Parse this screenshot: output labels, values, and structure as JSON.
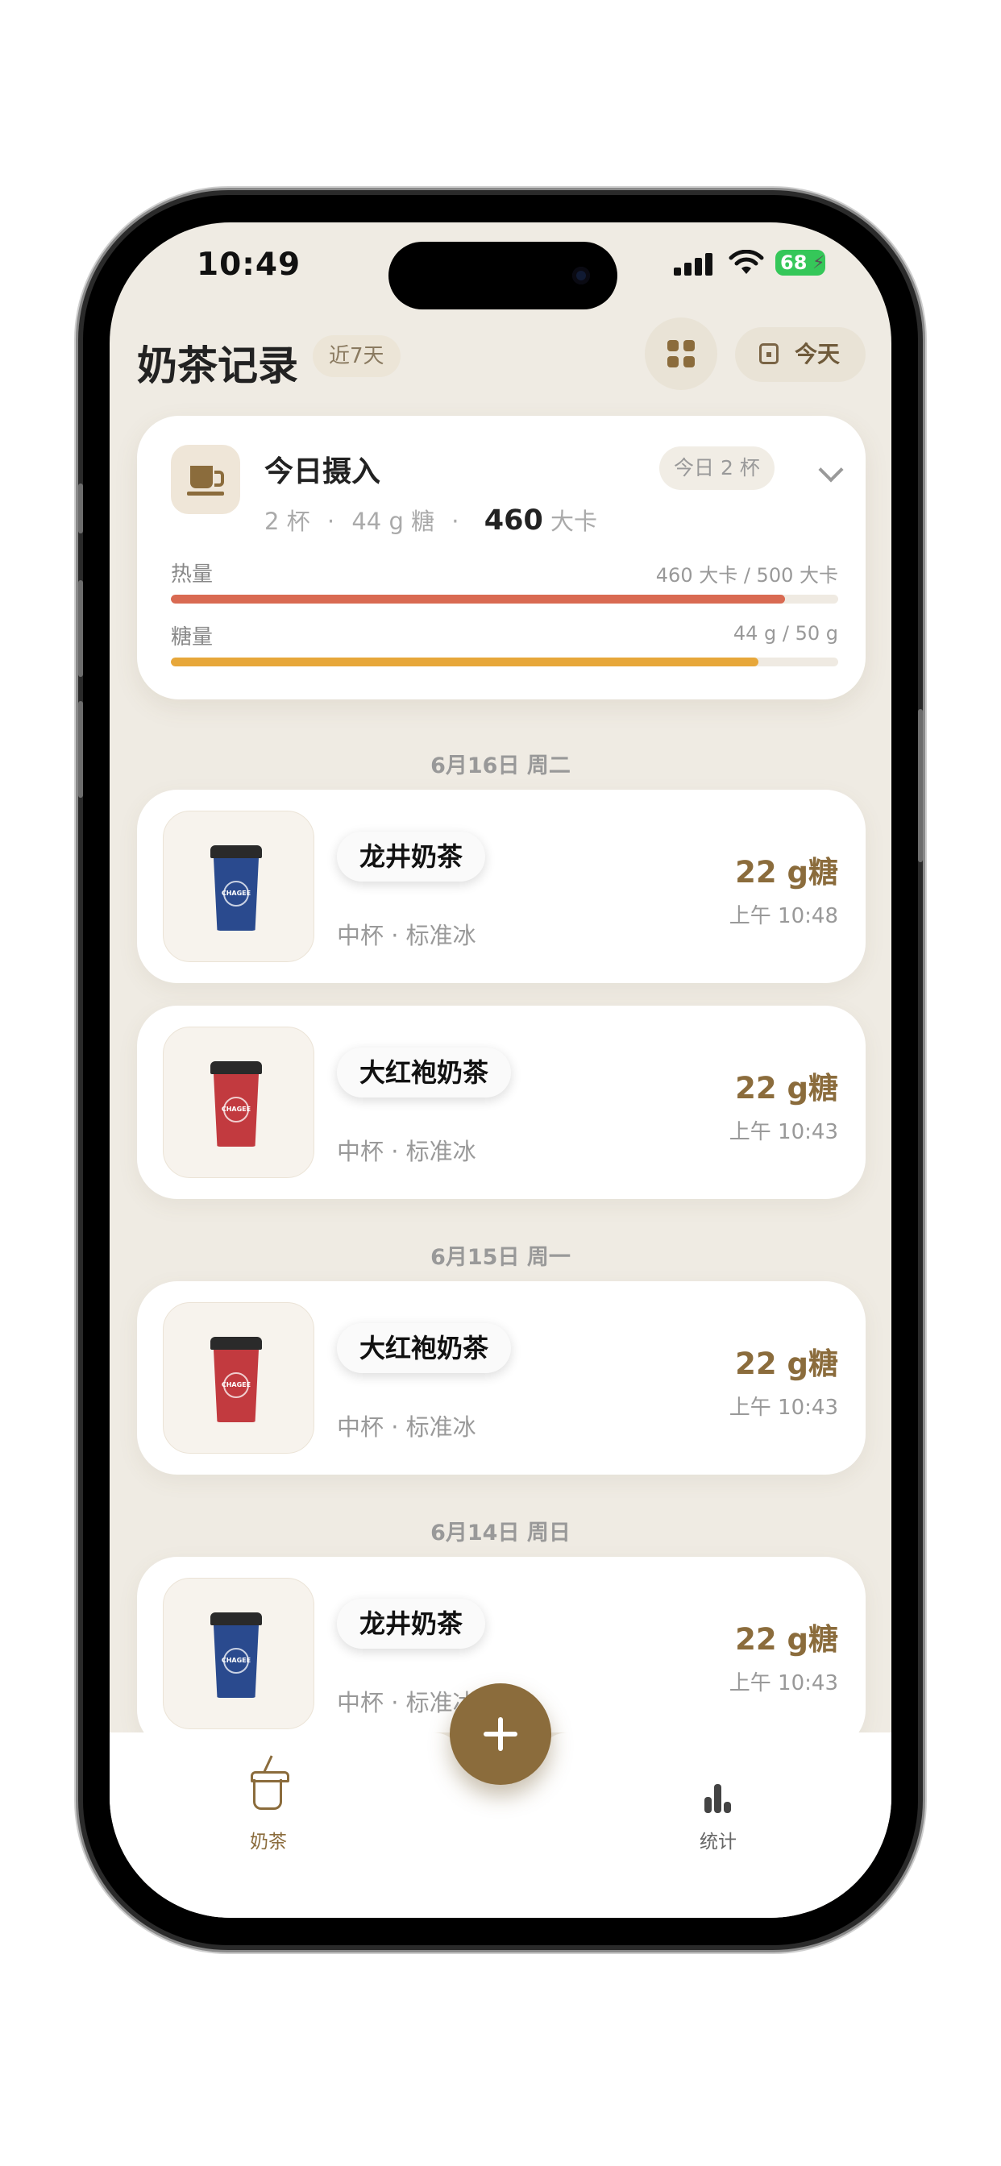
{
  "status": {
    "time": "10:49",
    "battery": "68"
  },
  "header": {
    "title": "奶茶记录",
    "range_badge": "近7天",
    "today_label": "今天"
  },
  "summary": {
    "title": "今日摄入",
    "cups_badge": "今日 2 杯",
    "sub_cups": "2 杯",
    "sub_sugar": "44 g 糖",
    "sub_dot": "·",
    "kcal_value": "460",
    "kcal_unit": "大卡",
    "calorie_label": "热量",
    "calorie_value": "460 大卡 / 500 大卡",
    "calorie_progress": 0.92,
    "sugar_label": "糖量",
    "sugar_value": "44 g / 50 g",
    "sugar_progress": 0.88,
    "colors": {
      "calorie_bar": "#d96a52",
      "sugar_bar": "#e7a73a",
      "accent": "#8b6c3c"
    }
  },
  "groups": [
    {
      "date": "6月16日 周二",
      "entries": [
        {
          "name": "龙井奶茶",
          "meta": "中杯 · 标准冰",
          "sugar": "22 g糖",
          "time": "上午 10:48",
          "cup_color": "#2a4a8e"
        },
        {
          "name": "大红袍奶茶",
          "meta": "中杯 · 标准冰",
          "sugar": "22 g糖",
          "time": "上午 10:43",
          "cup_color": "#c23a3f"
        }
      ]
    },
    {
      "date": "6月15日 周一",
      "entries": [
        {
          "name": "大红袍奶茶",
          "meta": "中杯 · 标准冰",
          "sugar": "22 g糖",
          "time": "上午 10:43",
          "cup_color": "#c23a3f"
        }
      ]
    },
    {
      "date": "6月14日 周日",
      "entries": [
        {
          "name": "龙井奶茶",
          "meta": "中杯 · 标准冰",
          "sugar": "22 g糖",
          "time": "上午 10:43",
          "cup_color": "#2a4a8e"
        }
      ]
    }
  ],
  "cup_brand": "CHAGEE",
  "tabs": [
    {
      "label": "奶茶",
      "icon": "milk-tea-icon",
      "active": true
    },
    {
      "label": "统计",
      "icon": "bar-chart-icon",
      "active": false
    }
  ],
  "fab": {
    "icon": "plus-icon"
  }
}
